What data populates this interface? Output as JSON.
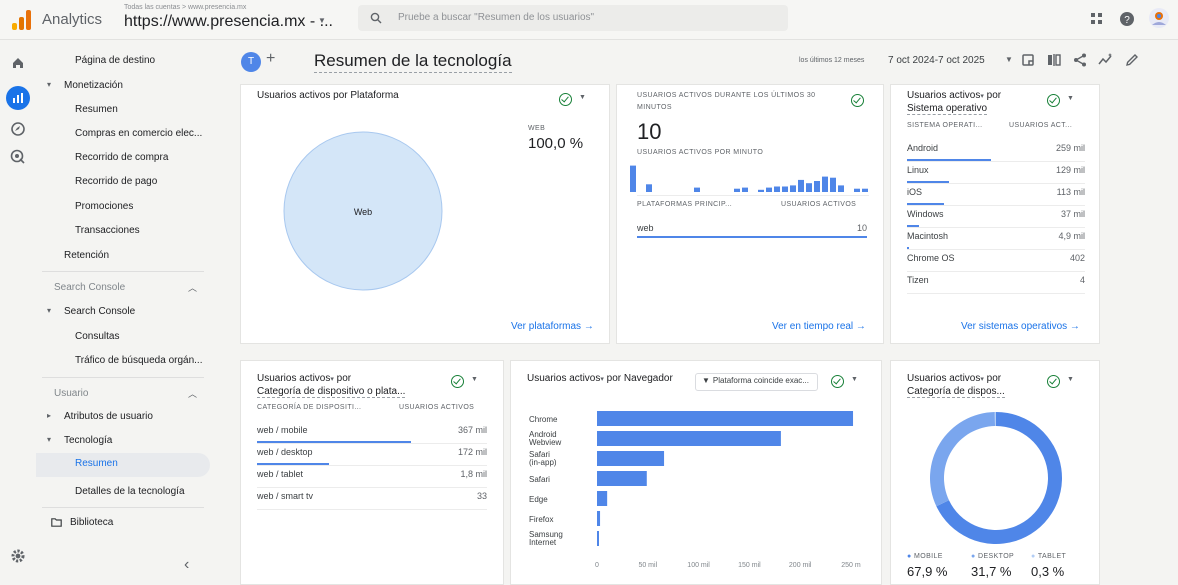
{
  "topbar": {
    "app_title": "Analytics",
    "account_path": "Todas las cuentas > www.presencia.mx",
    "account_name": "https://www.presencia.mx - ...",
    "search_placeholder": "Pruebe a buscar \"Resumen de los usuarios\"",
    "icons": [
      "apps-grid-icon",
      "help-icon",
      "user-avatar-icon"
    ]
  },
  "rail": {
    "icons": [
      "home-icon",
      "reports-icon",
      "explore-icon",
      "advertising-icon",
      "settings-icon"
    ]
  },
  "sidebar": {
    "items": [
      {
        "label": "Página de destino",
        "level": "sub"
      },
      {
        "label": "Monetización",
        "level": "top",
        "expanded": true
      },
      {
        "label": "Resumen",
        "level": "sub"
      },
      {
        "label": "Compras en comercio elec...",
        "level": "sub"
      },
      {
        "label": "Recorrido de compra",
        "level": "sub"
      },
      {
        "label": "Recorrido de pago",
        "level": "sub"
      },
      {
        "label": "Promociones",
        "level": "sub"
      },
      {
        "label": "Transacciones",
        "level": "sub"
      },
      {
        "label": "Retención",
        "level": "plain"
      }
    ],
    "section_search_console": "Search Console",
    "search_console_items": [
      {
        "label": "Search Console",
        "level": "top",
        "expanded": true
      },
      {
        "label": "Consultas",
        "level": "sub"
      },
      {
        "label": "Tráfico de búsqueda orgán...",
        "level": "sub"
      }
    ],
    "section_usuario": "Usuario",
    "usuario_items": [
      {
        "label": "Atributos de usuario",
        "level": "top",
        "expanded": false
      },
      {
        "label": "Tecnología",
        "level": "top",
        "expanded": true
      },
      {
        "label": "Resumen",
        "level": "sub",
        "active": true
      },
      {
        "label": "Detalles de la tecnología",
        "level": "sub"
      }
    ],
    "library": "Biblioteca",
    "collapse_glyph": "‹"
  },
  "header": {
    "avatar_letter": "T",
    "add_glyph": "+",
    "title": "Resumen de la tecnología",
    "date_prefix": "los últimos 12 meses",
    "date_range": "7 oct 2024-7 oct 2025",
    "icons": [
      "share-report-icon",
      "compare-icon",
      "share-icon",
      "insights-icon",
      "edit-icon"
    ]
  },
  "cards": {
    "platform": {
      "title": "Usuarios activos por Plataforma",
      "legend_label": "WEB",
      "legend_value": "100,0 %",
      "pie_label": "Web",
      "link": "Ver plataformas →"
    },
    "realtime": {
      "title_line1": "USUARIOS ACTIVOS DURANTE LOS ÚLTIMOS 30",
      "title_line2": "MINUTOS",
      "big_value": "10",
      "per_minute_label": "USUARIOS ACTIVOS POR MINUTO",
      "col1": "PLATAFORMAS PRINCIP...",
      "col2": "USUARIOS ACTIVOS",
      "rows": [
        {
          "label": "web",
          "value": "10"
        }
      ],
      "link": "Ver en tiempo real →",
      "bar_heights": [
        2.4,
        0,
        0.7,
        0,
        0,
        0,
        0,
        0,
        0.4,
        0,
        0,
        0,
        0,
        0.3,
        0.4,
        0,
        0.2,
        0.4,
        0.5,
        0.5,
        0.6,
        1.1,
        0.8,
        1.0,
        1.4,
        1.3,
        0.6,
        0,
        0.3,
        0.3
      ]
    },
    "os": {
      "title_line1": "Usuarios activos",
      "title_line1_suffix": " por",
      "title_line2": "Sistema operativo",
      "col1": "SISTEMA OPERATI...",
      "col2": "USUARIOS ACT...",
      "rows": [
        {
          "label": "Android",
          "value": "259 mil",
          "share": 1.0
        },
        {
          "label": "Linux",
          "value": "129 mil",
          "share": 0.5
        },
        {
          "label": "iOS",
          "value": "113 mil",
          "share": 0.44
        },
        {
          "label": "Windows",
          "value": "37 mil",
          "share": 0.14
        },
        {
          "label": "Macintosh",
          "value": "4,9 mil",
          "share": 0.02
        },
        {
          "label": "Chrome OS",
          "value": "402",
          "share": 0.0
        },
        {
          "label": "Tizen",
          "value": "4",
          "share": 0.0
        }
      ],
      "link": "Ver sistemas operativos →"
    },
    "device_category": {
      "title_line1": "Usuarios activos",
      "title_line1_suffix": " por",
      "title_line2": "Categoría de dispositivo o plata...",
      "col1": "CATEGORÍA DE DISPOSITI...",
      "col2": "USUARIOS ACTIVOS",
      "rows": [
        {
          "label": "web / mobile",
          "value": "367 mil",
          "share": 1.0
        },
        {
          "label": "web / desktop",
          "value": "172 mil",
          "share": 0.47
        },
        {
          "label": "web / tablet",
          "value": "1,8 mil",
          "share": 0.0
        },
        {
          "label": "web / smart tv",
          "value": "33",
          "share": 0.0
        }
      ]
    },
    "browser": {
      "title_prefix": "Usuarios activos",
      "title_suffix": " por Navegador",
      "filter_label": "Plataforma coincide exac...",
      "filter_icon": "filter-icon"
    },
    "device_donut": {
      "title_line1": "Usuarios activos",
      "title_line1_suffix": " por",
      "title_line2": "Categoría de dispos...",
      "legend": [
        {
          "label": "MOBILE",
          "value": "67,9 %",
          "color": "#4f86e8"
        },
        {
          "label": "DESKTOP",
          "value": "31,7 %",
          "color": "#7aa6ee"
        },
        {
          "label": "TABLET",
          "value": "0,3 %",
          "color": "#b3cef5"
        }
      ]
    }
  },
  "chart_data": {
    "type": "bar",
    "orientation": "horizontal",
    "categories": [
      "Chrome",
      "Android Webview",
      "Safari (in-app)",
      "Safari",
      "Edge",
      "Firefox",
      "Samsung Internet"
    ],
    "values": [
      252000,
      181000,
      66000,
      49000,
      10000,
      3000,
      1500
    ],
    "xlim": [
      0,
      250000
    ],
    "x_tick_labels": [
      "0",
      "50 mil",
      "100 mil",
      "150 mil",
      "200 mil",
      "250 m"
    ],
    "color": "#4f86e8"
  },
  "colors": {
    "accent": "#1a73e8",
    "bar": "#4f86e8",
    "check": "#188038",
    "pie_fill": "#d4e6f8"
  }
}
